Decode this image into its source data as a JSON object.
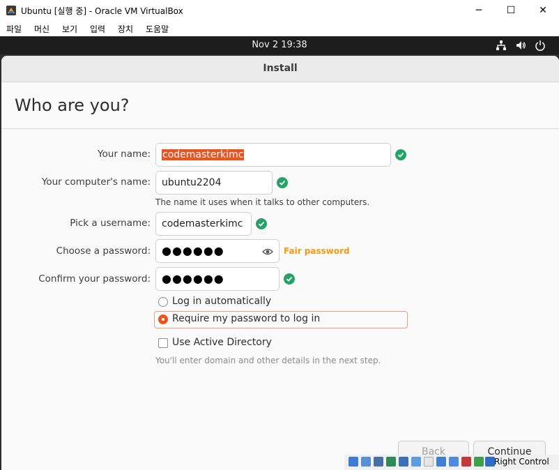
{
  "window": {
    "title": "Ubuntu [실행 중] - Oracle VM VirtualBox",
    "minimize_glyph": "─",
    "maximize_glyph": "☐",
    "close_glyph": "✕"
  },
  "menu": {
    "items": [
      "파일",
      "머신",
      "보기",
      "입력",
      "장치",
      "도움말"
    ]
  },
  "topbar": {
    "clock": "Nov 2  19:38",
    "icons": [
      "network-icon",
      "volume-icon",
      "power-icon"
    ]
  },
  "installer": {
    "header_title": "Install",
    "page_title": "Who are you?",
    "fields": {
      "your_name": {
        "label": "Your name:",
        "value": "codemasterkimc"
      },
      "computer_name": {
        "label": "Your computer's name:",
        "value": "ubuntu2204",
        "hint": "The name it uses when it talks to other computers."
      },
      "username": {
        "label": "Pick a username:",
        "value": "codemasterkimc"
      },
      "password": {
        "label": "Choose a password:",
        "value": "●●●●●●",
        "strength": "Fair password"
      },
      "confirm": {
        "label": "Confirm your password:",
        "value": "●●●●●●"
      }
    },
    "login_options": {
      "auto": {
        "label": "Log in automatically",
        "selected": false
      },
      "require": {
        "label": "Require my password to log in",
        "selected": true
      }
    },
    "active_directory": {
      "label": "Use Active Directory",
      "checked": false,
      "hint": "You'll enter domain and other details in the next step."
    },
    "buttons": {
      "back": "Back",
      "continue": "Continue"
    }
  },
  "statusbar": {
    "host_key_label": "Right Control"
  },
  "colors": {
    "accent": "#e95420",
    "success": "#26a269",
    "warning": "#f29a13",
    "topbar": "#1d1d1d"
  }
}
